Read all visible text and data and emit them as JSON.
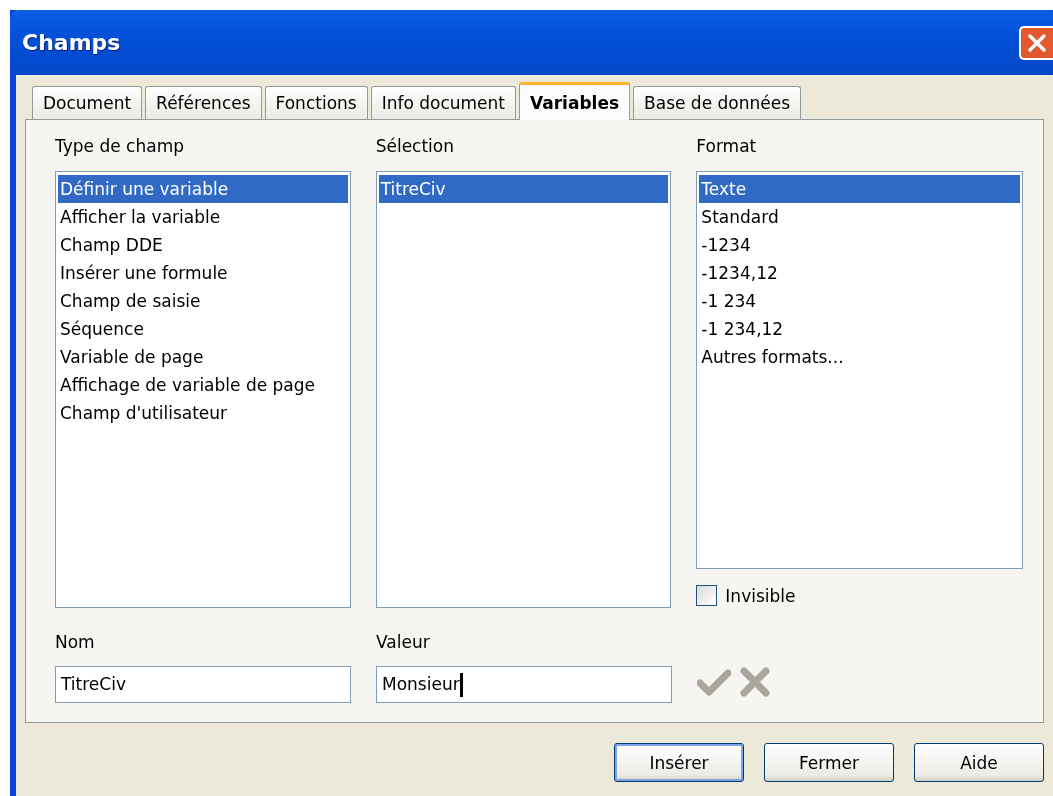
{
  "window": {
    "title": "Champs"
  },
  "tabs": [
    {
      "label": "Document",
      "selected": false
    },
    {
      "label": "Références",
      "selected": false
    },
    {
      "label": "Fonctions",
      "selected": false
    },
    {
      "label": "Info document",
      "selected": false
    },
    {
      "label": "Variables",
      "selected": true
    },
    {
      "label": "Base de données",
      "selected": false
    }
  ],
  "lists": [
    {
      "label": "Type de champ",
      "items": [
        {
          "text": "Définir une variable",
          "selected": true
        },
        {
          "text": "Afficher la variable",
          "selected": false
        },
        {
          "text": "Champ DDE",
          "selected": false
        },
        {
          "text": "Insérer une formule",
          "selected": false
        },
        {
          "text": "Champ de saisie",
          "selected": false
        },
        {
          "text": "Séquence",
          "selected": false
        },
        {
          "text": "Variable de page",
          "selected": false
        },
        {
          "text": "Affichage de variable de page",
          "selected": false
        },
        {
          "text": "Champ d'utilisateur",
          "selected": false
        }
      ]
    },
    {
      "label": "Sélection",
      "items": [
        {
          "text": "TitreCiv",
          "selected": true
        }
      ]
    },
    {
      "label": "Format",
      "items": [
        {
          "text": "Texte",
          "selected": true
        },
        {
          "text": "Standard",
          "selected": false
        },
        {
          "text": "-1234",
          "selected": false
        },
        {
          "text": "-1234,12",
          "selected": false
        },
        {
          "text": "-1 234",
          "selected": false
        },
        {
          "text": "-1 234,12",
          "selected": false
        },
        {
          "text": "Autres formats...",
          "selected": false
        }
      ]
    }
  ],
  "invisible": {
    "label": "Invisible",
    "checked": false
  },
  "fields": [
    {
      "label": "Nom",
      "value": "TitreCiv"
    },
    {
      "label": "Valeur",
      "value": "Monsieur"
    }
  ],
  "buttons": [
    {
      "label": "Insérer",
      "default": true
    },
    {
      "label": "Fermer",
      "default": false
    },
    {
      "label": "Aide",
      "default": false
    }
  ]
}
